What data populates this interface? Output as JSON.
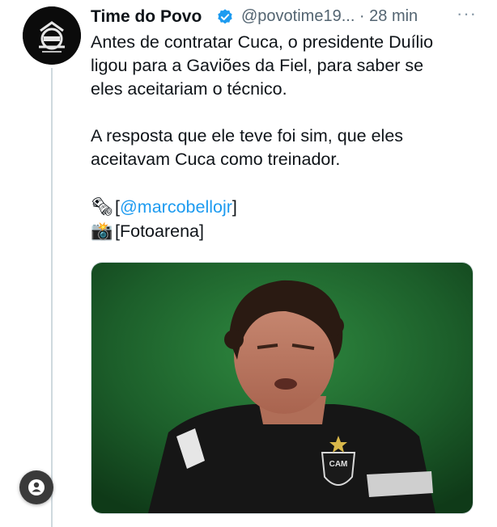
{
  "tweet": {
    "display_name": "Time do Povo",
    "handle_time": "@povotime19... · 28 min",
    "more_icon": "more-horizontal-icon",
    "verified_color": "#1d9bf0",
    "lines_p1": [
      "Antes de contratar Cuca, o presidente Duílio",
      "ligou para a Gaviões da Fiel, para saber se",
      "eles aceitariam o técnico."
    ],
    "lines_p2": [
      "A resposta que ele teve foi sim, que eles",
      "aceitavam Cuca como treinador."
    ],
    "credit_line1_open": "[",
    "credit_mention": "@marcobellojr",
    "credit_line1_close": "]",
    "credit_line2": "[Fotoarena]",
    "credit_icon1": "newspaper-icon",
    "credit_icon2": "camera-flash-icon",
    "crest_letters": "CAM"
  },
  "floating_button_icon": "user-icon"
}
